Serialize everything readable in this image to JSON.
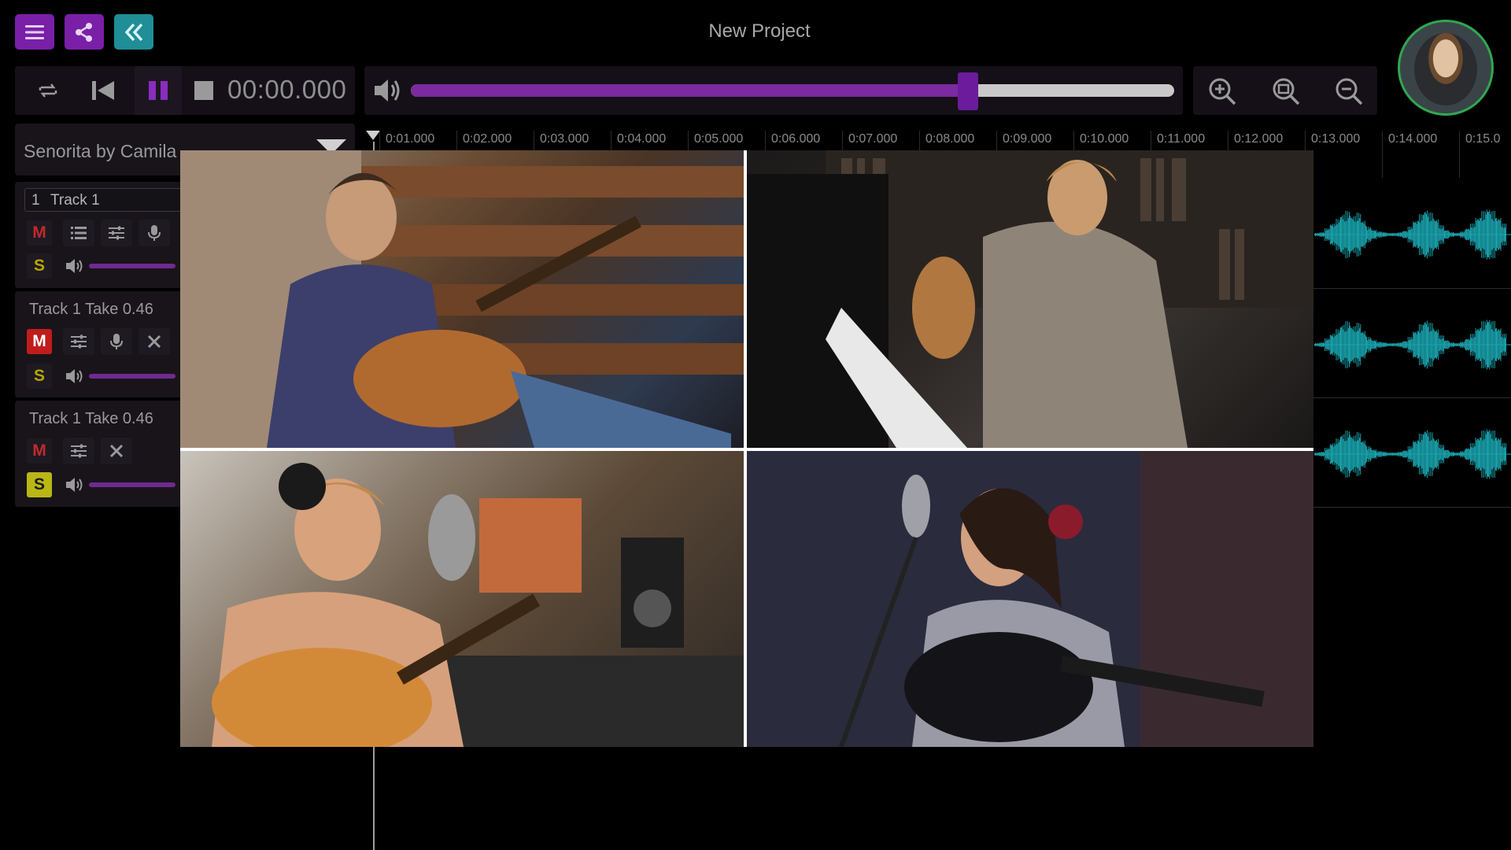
{
  "app": {
    "project_title": "New Project"
  },
  "transport": {
    "timecode": "00:00.000",
    "master_volume": 0.73
  },
  "song": {
    "selected": "Senorita by Camila"
  },
  "ruler": {
    "ticks": [
      "0:01.000",
      "0:02.000",
      "0:03.000",
      "0:04.000",
      "0:05.000",
      "0:06.000",
      "0:07.000",
      "0:08.000",
      "0:09.000",
      "0:10.000",
      "0:11.000",
      "0:12.000",
      "0:13.000",
      "0:14.000",
      "0:15.0"
    ]
  },
  "tracks": [
    {
      "number": "1",
      "name": "Track 1",
      "mute_label": "M",
      "solo_label": "S",
      "mute_on": false,
      "solo_on": false
    },
    {
      "name": "Track 1 Take 0.46",
      "mute_label": "M",
      "solo_label": "S",
      "mute_on": true,
      "solo_on": false
    },
    {
      "name": "Track 1 Take 0.46",
      "mute_label": "M",
      "solo_label": "S",
      "mute_on": false,
      "solo_on": true
    }
  ],
  "colors": {
    "accent_purple": "#7a1fa8",
    "accent_teal": "#1f8e96",
    "waveform": "#1aa3ad",
    "mute_red": "#c01c1c",
    "solo_yellow": "#b9b615"
  },
  "icons": {
    "menu": "hamburger-icon",
    "share": "share-icon",
    "collapse": "double-chevron-left-icon",
    "loop": "loop-icon",
    "rewind": "skip-to-start-icon",
    "pause": "pause-icon",
    "stop": "stop-icon",
    "volume": "speaker-icon",
    "zoom_in": "zoom-in-icon",
    "zoom_fit": "zoom-fit-icon",
    "zoom_out": "zoom-out-icon"
  }
}
